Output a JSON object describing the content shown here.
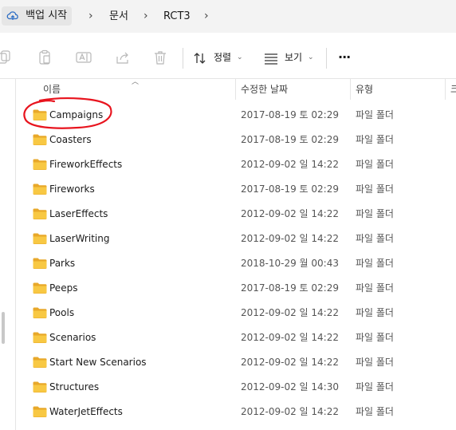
{
  "breadcrumb": {
    "items": [
      {
        "label": "백업 시작"
      },
      {
        "label": "문서"
      },
      {
        "label": "RCT3"
      }
    ]
  },
  "toolbar": {
    "sort_label": "정렬",
    "view_label": "보기",
    "more_label": "···"
  },
  "columns": {
    "name": "이름",
    "date": "수정한 날짜",
    "type": "유형",
    "size": "크"
  },
  "files": [
    {
      "name": "Campaigns",
      "date": "2017-08-19 토 02:29",
      "type": "파일 폴더"
    },
    {
      "name": "Coasters",
      "date": "2017-08-19 토 02:29",
      "type": "파일 폴더"
    },
    {
      "name": "FireworkEffects",
      "date": "2012-09-02 일 14:22",
      "type": "파일 폴더"
    },
    {
      "name": "Fireworks",
      "date": "2017-08-19 토 02:29",
      "type": "파일 폴더"
    },
    {
      "name": "LaserEffects",
      "date": "2012-09-02 일 14:22",
      "type": "파일 폴더"
    },
    {
      "name": "LaserWriting",
      "date": "2012-09-02 일 14:22",
      "type": "파일 폴더"
    },
    {
      "name": "Parks",
      "date": "2018-10-29 월 00:43",
      "type": "파일 폴더"
    },
    {
      "name": "Peeps",
      "date": "2017-08-19 토 02:29",
      "type": "파일 폴더"
    },
    {
      "name": "Pools",
      "date": "2012-09-02 일 14:22",
      "type": "파일 폴더"
    },
    {
      "name": "Scenarios",
      "date": "2012-09-02 일 14:22",
      "type": "파일 폴더"
    },
    {
      "name": "Start New Scenarios",
      "date": "2012-09-02 일 14:22",
      "type": "파일 폴더"
    },
    {
      "name": "Structures",
      "date": "2012-09-02 일 14:30",
      "type": "파일 폴더"
    },
    {
      "name": "WaterJetEffects",
      "date": "2012-09-02 일 14:22",
      "type": "파일 폴더"
    }
  ],
  "colors": {
    "folder": "#f8c843",
    "folder_dark": "#e8a82a",
    "annotation": "#e8141e"
  }
}
